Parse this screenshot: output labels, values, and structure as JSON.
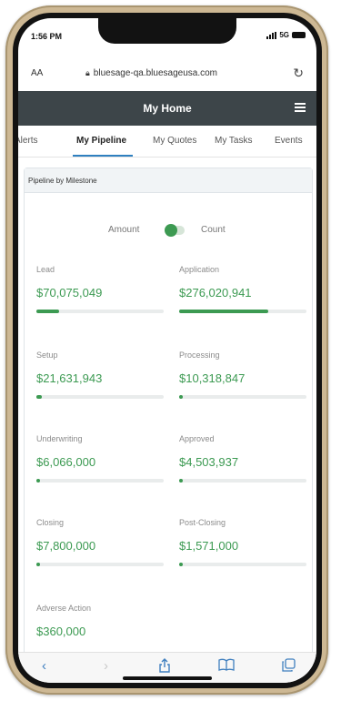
{
  "status": {
    "time": "1:56 PM",
    "network": "5G"
  },
  "browser": {
    "text_size": "AA",
    "url": "bluesage-qa.bluesageusa.com"
  },
  "header": {
    "title": "My Home"
  },
  "tabs": [
    "Alerts",
    "My Pipeline",
    "My Quotes",
    "My Tasks",
    "Events"
  ],
  "active_tab": "My Pipeline",
  "panel": {
    "title": "Pipeline by Milestone",
    "toggle": {
      "left_label": "Amount",
      "right_label": "Count",
      "state": "Amount"
    },
    "milestones": [
      {
        "label": "Lead",
        "value": "$70,075,049",
        "progress": 0.18
      },
      {
        "label": "Application",
        "value": "$276,020,941",
        "progress": 0.7
      },
      {
        "label": "Setup",
        "value": "$21,631,943",
        "progress": 0.04
      },
      {
        "label": "Processing",
        "value": "$10,318,847",
        "progress": 0.03
      },
      {
        "label": "Underwriting",
        "value": "$6,066,000",
        "progress": 0.03
      },
      {
        "label": "Approved",
        "value": "$4,503,937",
        "progress": 0.03
      },
      {
        "label": "Closing",
        "value": "$7,800,000",
        "progress": 0.03
      },
      {
        "label": "Post-Closing",
        "value": "$1,571,000",
        "progress": 0.02
      },
      {
        "label": "Adverse Action",
        "value": "$360,000",
        "progress": 0.01
      }
    ]
  },
  "colors": {
    "accent_green": "#3c9a52",
    "header_bg": "#3d4549",
    "tab_underline": "#2f80c0",
    "safari_blue": "#3f7fbf"
  },
  "toolbar_icons": [
    "back-icon",
    "forward-icon",
    "share-icon",
    "bookmarks-icon",
    "tabs-icon"
  ]
}
